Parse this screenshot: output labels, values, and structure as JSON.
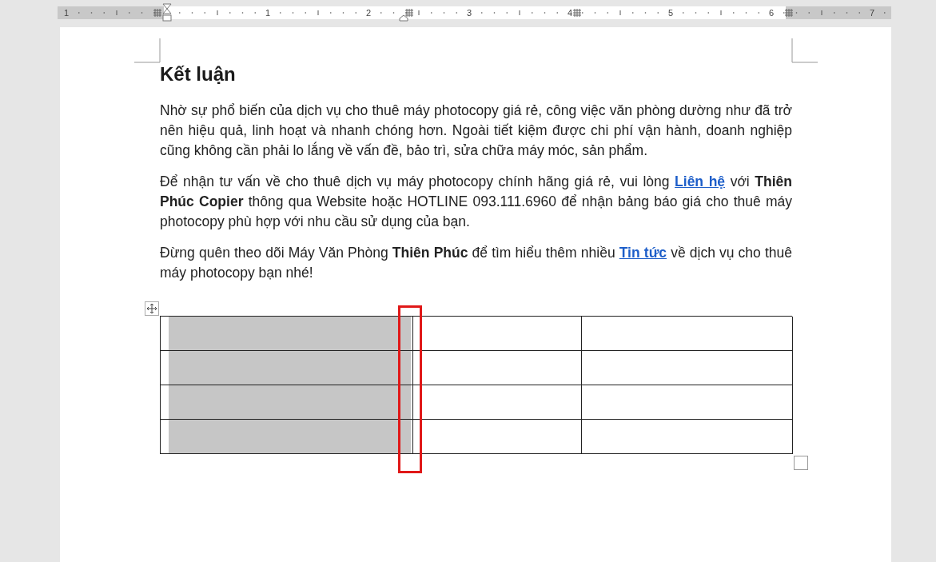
{
  "ruler": {
    "labels": [
      "1",
      "1",
      "2",
      "3",
      "4",
      "5",
      "6",
      "7"
    ]
  },
  "document": {
    "heading": "Kết luận",
    "paragraphs": [
      [
        {
          "kind": "text",
          "text": "Nhờ sự phổ biến của dịch vụ cho thuê máy photocopy giá rẻ, công việc văn phòng dường như đã trở nên hiệu quả, linh hoạt và nhanh chóng hơn. Ngoài tiết kiệm được chi phí vận hành, doanh nghiệp cũng không cần phải lo lắng về vấn đề, bảo trì, sửa chữa máy móc, sản phẩm."
        }
      ],
      [
        {
          "kind": "text",
          "text": "Để nhận tư vấn về cho thuê dịch vụ máy photocopy chính hãng giá rẻ, vui lòng "
        },
        {
          "kind": "link",
          "text": "Liên hệ"
        },
        {
          "kind": "text",
          "text": " với "
        },
        {
          "kind": "bold",
          "text": "Thiên Phúc Copier"
        },
        {
          "kind": "text",
          "text": " thông qua Website hoặc HOTLINE 093.111.6960 để nhận bảng báo giá cho thuê máy photocopy phù hợp với nhu cầu sử dụng của bạn."
        }
      ],
      [
        {
          "kind": "text",
          "text": "Đừng quên theo dõi Máy Văn Phòng "
        },
        {
          "kind": "bold",
          "text": "Thiên Phúc"
        },
        {
          "kind": "text",
          "text": " để tìm hiểu thêm nhiều "
        },
        {
          "kind": "link",
          "text": "Tin tức"
        },
        {
          "kind": "text",
          "text": " về dịch vụ cho thuê máy photocopy bạn nhé!"
        }
      ]
    ],
    "table": {
      "rows": [
        [
          {
            "selected": true
          },
          {
            "selected": false
          },
          {
            "selected": false
          }
        ],
        [
          {
            "selected": true
          },
          {
            "selected": false
          },
          {
            "selected": false
          }
        ],
        [
          {
            "selected": true
          },
          {
            "selected": false
          },
          {
            "selected": false
          }
        ],
        [
          {
            "selected": true
          },
          {
            "selected": false
          },
          {
            "selected": false
          }
        ]
      ]
    }
  }
}
